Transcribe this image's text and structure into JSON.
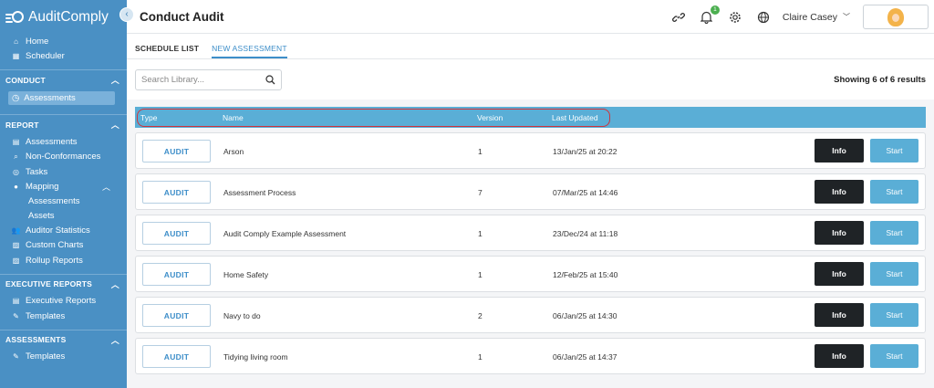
{
  "app": {
    "name": "AuditComply"
  },
  "sidebar": {
    "top_items": [
      {
        "label": "Home",
        "icon": "home-icon"
      },
      {
        "label": "Scheduler",
        "icon": "calendar-icon"
      }
    ],
    "conduct": {
      "title": "CONDUCT",
      "items": [
        {
          "label": "Assessments",
          "icon": "clock-icon"
        }
      ]
    },
    "report": {
      "title": "REPORT",
      "items": [
        {
          "label": "Assessments",
          "icon": "list-icon"
        },
        {
          "label": "Non-Conformances",
          "icon": "search-icon"
        },
        {
          "label": "Tasks",
          "icon": "target-icon"
        },
        {
          "label": "Mapping",
          "icon": "pin-icon"
        }
      ],
      "mapping_sub": [
        "Assessments",
        "Assets"
      ],
      "more_items": [
        {
          "label": "Auditor Statistics",
          "icon": "users-icon"
        },
        {
          "label": "Custom Charts",
          "icon": "chart-icon"
        },
        {
          "label": "Rollup Reports",
          "icon": "chart-icon"
        }
      ]
    },
    "executive": {
      "title": "EXECUTIVE REPORTS",
      "items": [
        {
          "label": "Executive Reports",
          "icon": "list-icon"
        },
        {
          "label": "Templates",
          "icon": "edit-icon"
        }
      ]
    },
    "assessments": {
      "title": "ASSESSMENTS",
      "items": [
        {
          "label": "Templates",
          "icon": "edit-icon"
        }
      ]
    }
  },
  "header": {
    "title": "Conduct Audit",
    "notification_count": "1",
    "user_name": "Claire Casey"
  },
  "tabs": [
    "SCHEDULE LIST",
    "NEW ASSESSMENT"
  ],
  "search": {
    "placeholder": "Search Library..."
  },
  "results_text": "Showing 6 of 6 results",
  "table": {
    "headers": {
      "type": "Type",
      "name": "Name",
      "version": "Version",
      "updated": "Last Updated"
    },
    "rows": [
      {
        "type": "AUDIT",
        "name": "Arson",
        "version": "1",
        "updated": "13/Jan/25 at 20:22"
      },
      {
        "type": "AUDIT",
        "name": "Assessment Process",
        "version": "7",
        "updated": "07/Mar/25 at 14:46"
      },
      {
        "type": "AUDIT",
        "name": "Audit Comply Example Assessment",
        "version": "1",
        "updated": "23/Dec/24 at 11:18"
      },
      {
        "type": "AUDIT",
        "name": "Home Safety",
        "version": "1",
        "updated": "12/Feb/25 at 15:40"
      },
      {
        "type": "AUDIT",
        "name": "Navy to do",
        "version": "2",
        "updated": "06/Jan/25 at 14:30"
      },
      {
        "type": "AUDIT",
        "name": "Tidying living room",
        "version": "1",
        "updated": "06/Jan/25 at 14:37"
      }
    ],
    "info_label": "Info",
    "start_label": "Start"
  },
  "colors": {
    "sidebar": "#4a90c4",
    "accent": "#5aaed6",
    "dark_button": "#1f2326",
    "highlight": "#d2333a"
  }
}
